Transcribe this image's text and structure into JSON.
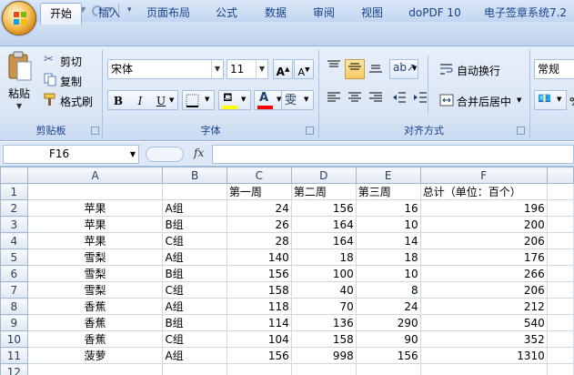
{
  "quick_access": {
    "save_icon": "save-icon",
    "undo_icon": "undo-icon",
    "redo_icon": "redo-icon"
  },
  "tabs": [
    {
      "label": "开始"
    },
    {
      "label": "插入"
    },
    {
      "label": "页面布局"
    },
    {
      "label": "公式"
    },
    {
      "label": "数据"
    },
    {
      "label": "审阅"
    },
    {
      "label": "视图"
    },
    {
      "label": "doPDF 10"
    },
    {
      "label": "电子签章系统7.2"
    }
  ],
  "ribbon": {
    "clipboard": {
      "paste": "粘贴",
      "cut": "剪切",
      "copy": "复制",
      "format_painter": "格式刷",
      "label": "剪贴板"
    },
    "font": {
      "name": "宋体",
      "size": "11",
      "bold": "B",
      "italic": "I",
      "underline": "U",
      "label": "字体",
      "highlight_color": "#ffff00",
      "font_color": "#ff0000"
    },
    "alignment": {
      "wrap": "自动换行",
      "merge": "合并后居中",
      "label": "对齐方式"
    },
    "number": {
      "format": "常规"
    }
  },
  "formula_bar": {
    "cell_ref": "F16",
    "fx": "fx",
    "value": ""
  },
  "sheet": {
    "columns": [
      "A",
      "B",
      "C",
      "D",
      "E",
      "F"
    ],
    "rows": [
      {
        "n": "1",
        "a": "",
        "b": "",
        "c": "第一周",
        "d": "第二周",
        "e": "第三周",
        "f": "总计（单位：百个）"
      },
      {
        "n": "2",
        "a": "苹果",
        "b": "A组",
        "c": "24",
        "d": "156",
        "e": "16",
        "f": "196"
      },
      {
        "n": "3",
        "a": "苹果",
        "b": "B组",
        "c": "26",
        "d": "164",
        "e": "10",
        "f": "200"
      },
      {
        "n": "4",
        "a": "苹果",
        "b": "C组",
        "c": "28",
        "d": "164",
        "e": "14",
        "f": "206"
      },
      {
        "n": "5",
        "a": "雪梨",
        "b": "A组",
        "c": "140",
        "d": "18",
        "e": "18",
        "f": "176"
      },
      {
        "n": "6",
        "a": "雪梨",
        "b": "B组",
        "c": "156",
        "d": "100",
        "e": "10",
        "f": "266"
      },
      {
        "n": "7",
        "a": "雪梨",
        "b": "C组",
        "c": "158",
        "d": "40",
        "e": "8",
        "f": "206"
      },
      {
        "n": "8",
        "a": "香蕉",
        "b": "A组",
        "c": "118",
        "d": "70",
        "e": "24",
        "f": "212"
      },
      {
        "n": "9",
        "a": "香蕉",
        "b": "B组",
        "c": "114",
        "d": "136",
        "e": "290",
        "f": "540"
      },
      {
        "n": "10",
        "a": "香蕉",
        "b": "C组",
        "c": "104",
        "d": "158",
        "e": "90",
        "f": "352"
      },
      {
        "n": "11",
        "a": "菠萝",
        "b": "A组",
        "c": "156",
        "d": "998",
        "e": "156",
        "f": "1310"
      },
      {
        "n": "12",
        "a": "",
        "b": "",
        "c": "",
        "d": "",
        "e": "",
        "f": ""
      }
    ]
  }
}
